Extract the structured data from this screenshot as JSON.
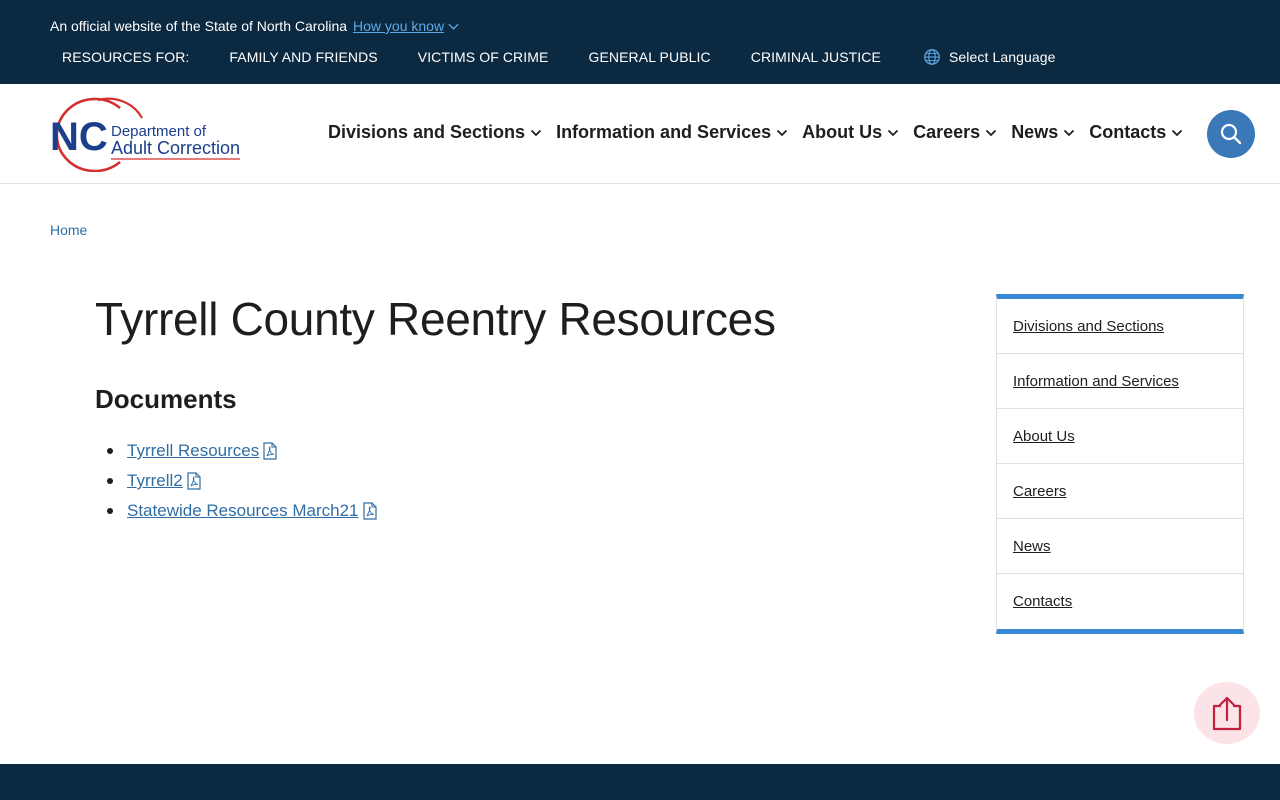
{
  "banner": {
    "official_text": "An official website of the State of North Carolina",
    "how_you_know": "How you know",
    "resources_label": "RESOURCES FOR:",
    "resources": [
      "FAMILY AND FRIENDS",
      "VICTIMS OF CRIME",
      "GENERAL PUBLIC",
      "CRIMINAL JUSTICE"
    ],
    "select_language": "Select Language"
  },
  "logo": {
    "initials": "NC",
    "line1": "Department of",
    "line2": "Adult Correction"
  },
  "nav": {
    "items": [
      "Divisions and Sections",
      "Information and Services",
      "About Us",
      "Careers",
      "News",
      "Contacts"
    ]
  },
  "breadcrumb": {
    "home": "Home"
  },
  "main": {
    "title": "Tyrrell County Reentry Resources",
    "documents_heading": "Documents",
    "documents": [
      "Tyrrell Resources",
      "Tyrrell2",
      "Statewide Resources March21"
    ]
  },
  "sidebar": {
    "items": [
      "Divisions and Sections",
      "Information and Services",
      "About Us",
      "Careers",
      "News",
      "Contacts"
    ]
  },
  "colors": {
    "banner_bg": "#0b2a42",
    "link_blue": "#2f6ea5",
    "accent_blue": "#3b8ad6",
    "search_bg": "#3a78b8",
    "logo_red": "#d32f2f",
    "logo_navy": "#1b3f8b"
  },
  "icons": {
    "how_you_know": "chevron-down-icon",
    "language": "globe-icon",
    "nav": "chevron-down-icon",
    "search": "search-icon",
    "pdf": "pdf-icon",
    "back_to_top": "arrow-up-icon"
  }
}
